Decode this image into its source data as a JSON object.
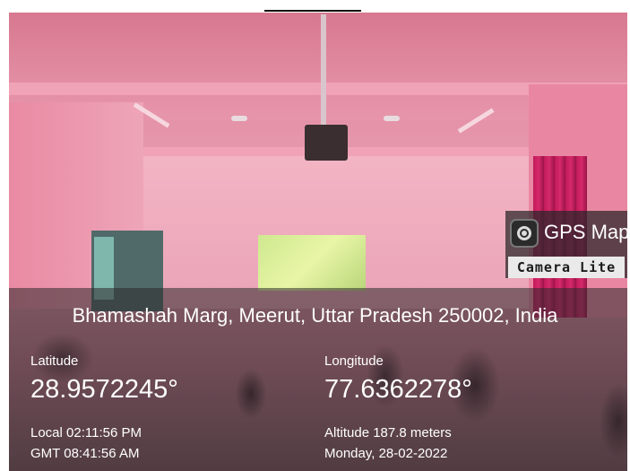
{
  "badge": {
    "title": "GPS Map",
    "subtitle": "Camera Lite",
    "icon": "gps-camera-icon"
  },
  "location": {
    "address": "Bhamashah Marg, Meerut, Uttar Pradesh 250002, India",
    "latitude_label": "Latitude",
    "latitude_value": "28.9572245°",
    "longitude_label": "Longitude",
    "longitude_value": "77.6362278°",
    "local_time": "Local 02:11:56 PM",
    "gmt_time": "GMT 08:41:56 AM",
    "altitude": "Altitude 187.8 meters",
    "date": "Monday, 28-02-2022"
  },
  "colors": {
    "overlay": "#2d282a",
    "text": "#ffffff",
    "room_tint": "#e596aa"
  }
}
